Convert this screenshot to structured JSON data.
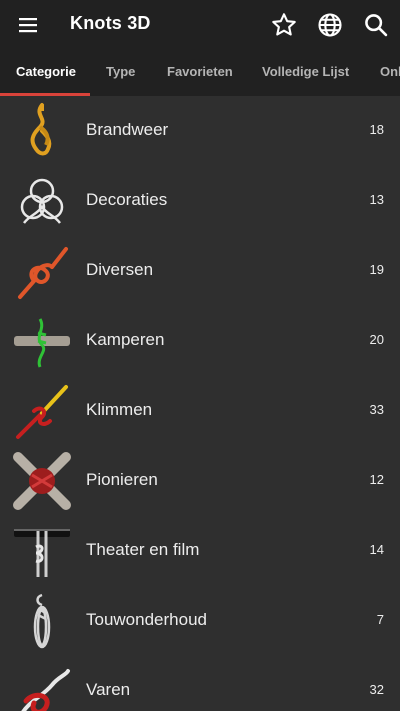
{
  "app": {
    "title": "Knots 3D",
    "icons": [
      "menu-icon",
      "star-icon",
      "globe-icon",
      "search-icon"
    ]
  },
  "tabs": [
    {
      "label": "Categorie",
      "active": true
    },
    {
      "label": "Type",
      "active": false
    },
    {
      "label": "Favorieten",
      "active": false
    },
    {
      "label": "Volledige Lijst",
      "active": false
    },
    {
      "label": "Onl",
      "active": false
    }
  ],
  "categories": [
    {
      "label": "Brandweer",
      "count": "18"
    },
    {
      "label": "Decoraties",
      "count": "13"
    },
    {
      "label": "Diversen",
      "count": "19"
    },
    {
      "label": "Kamperen",
      "count": "20"
    },
    {
      "label": "Klimmen",
      "count": "33"
    },
    {
      "label": "Pionieren",
      "count": "12"
    },
    {
      "label": "Theater en film",
      "count": "14"
    },
    {
      "label": "Touwonderhoud",
      "count": "7"
    },
    {
      "label": "Varen",
      "count": "32"
    }
  ],
  "colors": {
    "toolbar": "#212121",
    "background": "#2f2f2f",
    "accent": "#d9433a"
  }
}
